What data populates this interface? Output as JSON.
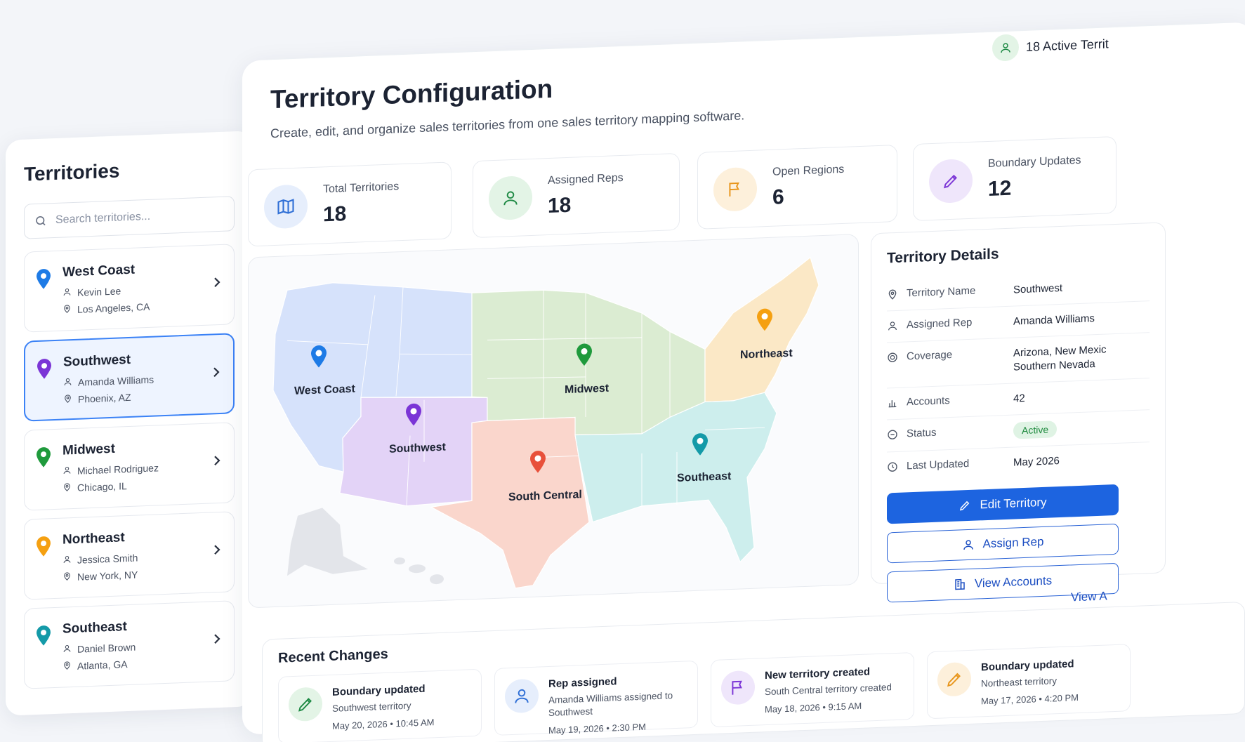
{
  "sidebar": {
    "title": "Territories",
    "search_placeholder": "Search territories...",
    "items": [
      {
        "name": "West Coast",
        "rep": "Kevin Lee",
        "location": "Los Angeles, CA",
        "color": "#1e7be6"
      },
      {
        "name": "Southwest",
        "rep": "Amanda Williams",
        "location": "Phoenix, AZ",
        "color": "#7b35d6"
      },
      {
        "name": "Midwest",
        "rep": "Michael Rodriguez",
        "location": "Chicago, IL",
        "color": "#1f9a3c"
      },
      {
        "name": "Northeast",
        "rep": "Jessica Smith",
        "location": "New York, NY",
        "color": "#f5a011"
      },
      {
        "name": "Southeast",
        "rep": "Daniel Brown",
        "location": "Atlanta, GA",
        "color": "#149aa8"
      }
    ],
    "selected": "Southwest"
  },
  "header": {
    "title": "Territory Configuration",
    "subtitle": "Create, edit, and organize sales territories from one sales territory mapping software.",
    "active_badge": "18 Active Territ"
  },
  "stats": [
    {
      "label": "Total Territories",
      "value": "18",
      "icon": "map-icon",
      "color": "#2f6fd6",
      "bg": "#e6eefc"
    },
    {
      "label": "Assigned Reps",
      "value": "18",
      "icon": "user-icon",
      "color": "#1f8a45",
      "bg": "#e3f4e6"
    },
    {
      "label": "Open Regions",
      "value": "6",
      "icon": "flag-icon",
      "color": "#e8951a",
      "bg": "#fdf0db"
    },
    {
      "label": "Boundary Updates",
      "value": "12",
      "icon": "pencil-icon",
      "color": "#7b35d6",
      "bg": "#efe6fb"
    }
  ],
  "map": {
    "regions": [
      {
        "name": "West Coast",
        "color": "#d6e2fb",
        "pin": "#1e7be6"
      },
      {
        "name": "Southwest",
        "color": "#e3d3f7",
        "pin": "#7b35d6"
      },
      {
        "name": "Midwest",
        "color": "#dbecd2",
        "pin": "#1f9a3c"
      },
      {
        "name": "Northeast",
        "color": "#fbe8c6",
        "pin": "#f5a011"
      },
      {
        "name": "South Central",
        "color": "#fad6cc",
        "pin": "#e8503a"
      },
      {
        "name": "Southeast",
        "color": "#cdeeed",
        "pin": "#149aa8"
      }
    ]
  },
  "details": {
    "title": "Territory Details",
    "rows": [
      {
        "label": "Territory Name",
        "value": "Southwest",
        "icon": "location-pin-icon"
      },
      {
        "label": "Assigned Rep",
        "value": "Amanda Williams",
        "icon": "user-icon"
      },
      {
        "label": "Coverage",
        "value": "Arizona, New Mexic Southern Nevada",
        "icon": "target-icon"
      },
      {
        "label": "Accounts",
        "value": "42",
        "icon": "bar-chart-icon"
      },
      {
        "label": "Status",
        "value": "Active",
        "icon": "status-icon"
      },
      {
        "label": "Last Updated",
        "value": "May 2026",
        "icon": "clock-icon"
      }
    ],
    "buttons": {
      "edit": "Edit Territory",
      "assign": "Assign Rep",
      "accounts": "View Accounts"
    }
  },
  "recent": {
    "title": "Recent Changes",
    "view_all": "View A",
    "items": [
      {
        "title": "Boundary updated",
        "desc": "Southwest territory",
        "time": "May 20, 2026 • 10:45 AM",
        "icon": "pencil-icon",
        "color": "#1f8a45",
        "bg": "#e3f4e6"
      },
      {
        "title": "Rep assigned",
        "desc": "Amanda Williams assigned to Southwest",
        "time": "May 19, 2026 • 2:30 PM",
        "icon": "user-icon",
        "color": "#2f6fd6",
        "bg": "#e6eefc"
      },
      {
        "title": "New territory created",
        "desc": "South Central territory created",
        "time": "May 18, 2026 • 9:15 AM",
        "icon": "flag-icon",
        "color": "#7b35d6",
        "bg": "#efe6fb"
      },
      {
        "title": "Boundary updated",
        "desc": "Northeast territory",
        "time": "May 17, 2026 • 4:20 PM",
        "icon": "pencil-icon",
        "color": "#e8951a",
        "bg": "#fdf0db"
      }
    ]
  }
}
